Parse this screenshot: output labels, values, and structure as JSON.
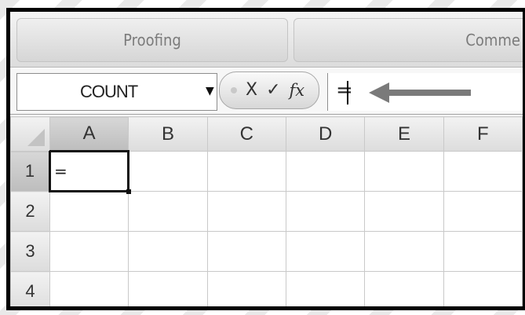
{
  "ribbon": {
    "groups": [
      {
        "label": "Proofing"
      },
      {
        "label": "Comme"
      }
    ]
  },
  "formula_bar": {
    "name_box_value": "COUNT",
    "cancel_symbol": "X",
    "enter_symbol": "✓",
    "function_symbol": "fx",
    "formula_value": "=",
    "icons": [
      "dropdown-arrow-icon",
      "cancel-icon",
      "enter-checkmark-icon",
      "insert-function-icon",
      "left-arrow-icon"
    ]
  },
  "sheet": {
    "columns": [
      "A",
      "B",
      "C",
      "D",
      "E",
      "F"
    ],
    "rows": [
      "1",
      "2",
      "3",
      "4"
    ],
    "active_cell": "A1",
    "cells": {
      "A1": "="
    }
  },
  "colors": {
    "frame": "#000000",
    "arrow": "#7a7a7a",
    "active_header": "#c8c8c8"
  }
}
